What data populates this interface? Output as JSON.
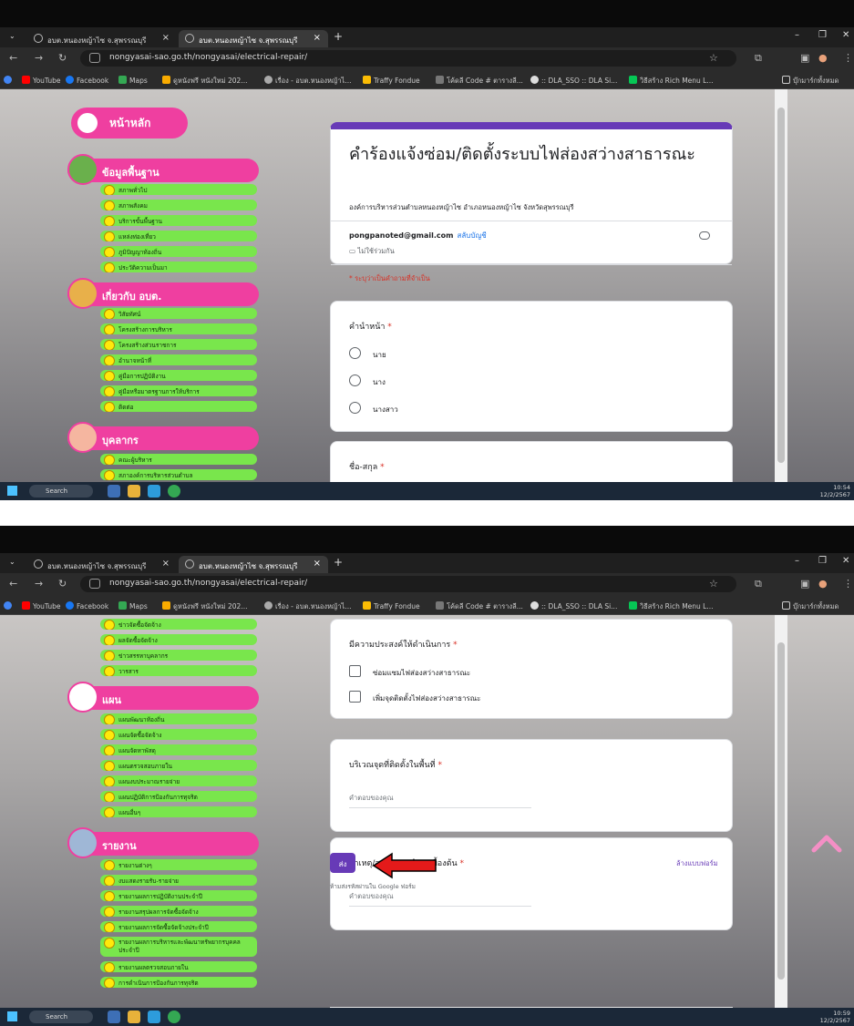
{
  "screenshot1": {
    "tabs": [
      "อบต.หนองหญ้าไซ จ.สุพรรณบุรี",
      "อบต.หนองหญ้าไซ จ.สุพรรณบุรี"
    ],
    "url": "nongyasai-sao.go.th/nongyasai/electrical-repair/",
    "bookmarks": [
      "YouTube",
      "Facebook",
      "Maps",
      "ดูหนังฟรี หนังใหม่ 202...",
      "เรื่อง - อบต.หนองหญ้าไ...",
      "Traffy Fondue",
      "โค้ดลี Code # ตารางลี...",
      ":: DLA_SSO :: DLA Si...",
      "วิธีสร้าง Rich Menu L...",
      "บุ๊กมาร์กทั้งหมด"
    ],
    "sidebar": {
      "home": "หน้าหลัก",
      "sections": [
        {
          "title": "ข้อมูลพื้นฐาน",
          "items": [
            "สภาพทั่วไป",
            "สภาพสังคม",
            "บริการขั้นพื้นฐาน",
            "แหล่งท่องเที่ยว",
            "ภูมิปัญญาท้องถิ่น",
            "ประวัติความเป็นมา"
          ]
        },
        {
          "title": "เกี่ยวกับ อบต.",
          "items": [
            "วิสัยทัศน์",
            "โครงสร้างการบริหาร",
            "โครงสร้างส่วนราชการ",
            "อำนาจหน้าที่",
            "คู่มือการปฏิบัติงาน",
            "คู่มือหรือมาตรฐานการให้บริการ",
            "ติดต่อ"
          ]
        },
        {
          "title": "บุคลากร",
          "items": [
            "คณะผู้บริหาร",
            "สภาองค์การบริหารส่วนตำบล"
          ]
        }
      ]
    },
    "form": {
      "title": "คำร้องแจ้งซ่อม/ติดตั้งระบบไฟส่องสว่างสาธารณะ",
      "description": "องค์การบริหารส่วนตำบลหนองหญ้าไซ อำเภอหนองหญ้าไซ จังหวัดสุพรรณบุรี",
      "email": "pongpanoted@gmail.com",
      "switch_account": "สลับบัญชี",
      "not_shared": "ไม่ใช้ร่วมกัน",
      "required_note": "* ระบุว่าเป็นคำถามที่จำเป็น",
      "q1_label": "คำนำหน้า",
      "q1_options": [
        "นาย",
        "นาง",
        "นางสาว"
      ],
      "q2_label": "ชื่อ-สกุล"
    },
    "taskbar": {
      "search": "Search",
      "time": "10:54",
      "date": "12/2/2567"
    }
  },
  "screenshot2": {
    "tabs": [
      "อบต.หนองหญ้าไซ จ.สุพรรณบุรี",
      "อบต.หนองหญ้าไซ จ.สุพรรณบุรี"
    ],
    "url": "nongyasai-sao.go.th/nongyasai/electrical-repair/",
    "bookmarks": [
      "YouTube",
      "Facebook",
      "Maps",
      "ดูหนังฟรี หนังใหม่ 202...",
      "เรื่อง - อบต.หนองหญ้าไ...",
      "Traffy Fondue",
      "โค้ดลี Code # ตารางลี...",
      ":: DLA_SSO :: DLA Si...",
      "วิธีสร้าง Rich Menu L...",
      "บุ๊กมาร์กทั้งหมด"
    ],
    "sidebar": {
      "top_items": [
        "ข่าวจัดซื้อจัดจ้าง",
        "ผลจัดซื้อจัดจ้าง",
        "ข่าวสรรหาบุคลากร",
        "วารสาร"
      ],
      "sections": [
        {
          "title": "แผน",
          "items": [
            "แผนพัฒนาท้องถิ่น",
            "แผนจัดซื้อจัดจ้าง",
            "แผนจัดหาพัสดุ",
            "แผนตรวจสอบภายใน",
            "แผนงบประมาณรายจ่าย",
            "แผนปฏิบัติการป้องกันการทุจริต",
            "แผนอื่นๆ"
          ]
        },
        {
          "title": "รายงาน",
          "items": [
            "รายงานต่างๆ",
            "งบแสดงรายรับ-รายจ่าย",
            "รายงานผลการปฏิบัติงานประจำปี",
            "รายงานสรุปผลการจัดซื้อจัดจ้าง",
            "รายงานผลการจัดซื้อจัดจ้างประจำปี",
            "รายงานผลการบริหารและพัฒนาทรัพยากรบุคคลประจำปี",
            "รายงานผลตรวจสอบภายใน",
            "การดำเนินการป้องกันการทุจริต"
          ]
        }
      ]
    },
    "form": {
      "q3_label": "มีความประสงค์ให้ดำเนินการ",
      "q3_options": [
        "ซ่อมแซมไฟส่องสว่างสาธารณะ",
        "เพิ่มจุดติดตั้งไฟส่องสว่างสาธารณะ"
      ],
      "q4_label": "บริเวณจุดที่ติดตั้งในพื้นที่",
      "q4_placeholder": "คำตอบของคุณ",
      "q5_label": "สาเหตุ/สภาพการชำรุดเบื้องต้น",
      "q5_placeholder": "คำตอบของคุณ",
      "submit": "ส่ง",
      "clear": "ล้างแบบฟอร์ม",
      "never_submit": "ห้ามส่งรหัสผ่านใน Google ฟอร์ม"
    },
    "taskbar": {
      "search": "Search",
      "time": "10:59",
      "date": "12/2/2567"
    }
  },
  "colors": {
    "pink": "#ef3fa0",
    "green": "#79e64c",
    "purple": "#673ab7",
    "red": "#d93025"
  }
}
